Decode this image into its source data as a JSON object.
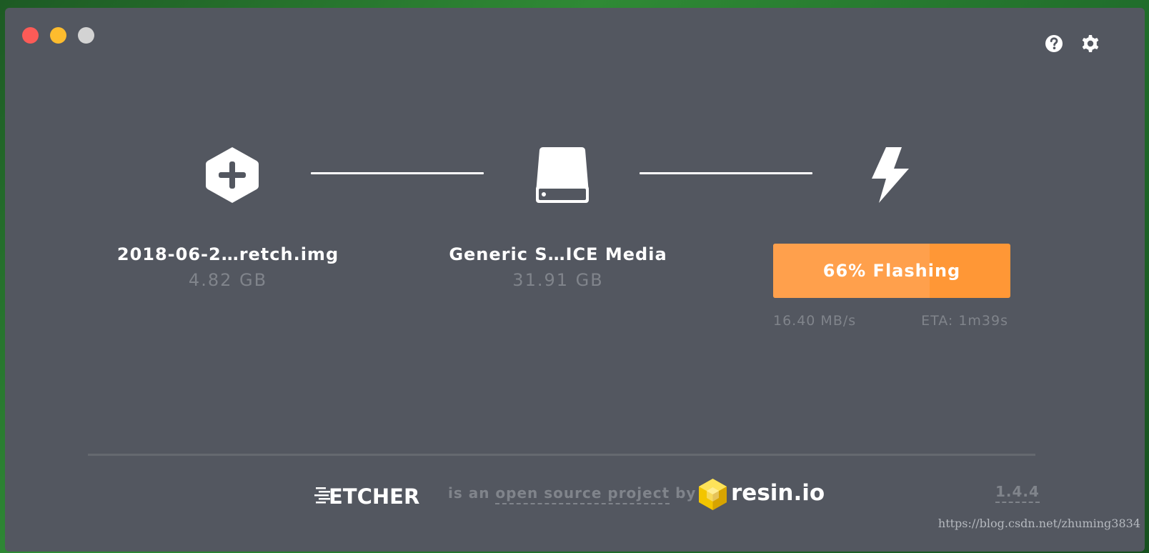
{
  "window": {
    "controls": {
      "close_color": "#fc5b57",
      "minimize_color": "#fdbc2e",
      "maximize_color": "#d3d3d3"
    },
    "top_icons": [
      "help-icon",
      "gear-icon"
    ]
  },
  "steps": {
    "image": {
      "icon": "hexagon-plus-icon",
      "title": "2018-06-2…retch.img",
      "size": "4.82 GB"
    },
    "drive": {
      "icon": "drive-icon",
      "title": "Generic S…ICE Media",
      "size": "31.91 GB"
    },
    "flash": {
      "icon": "lightning-icon",
      "progress_label": "66% Flashing",
      "progress_percent": 66,
      "speed": "16.40 MB/s",
      "eta": "ETA: 1m39s",
      "colors": {
        "accent": "#ff9736",
        "fill": "#ffa04c"
      }
    }
  },
  "footer": {
    "brand_text": "ETCHER",
    "tagline_prefix": "is an ",
    "tagline_link": "open source project",
    "tagline_suffix": " by",
    "company_logo_text": "resin.io",
    "version": "1.4.4"
  },
  "watermark": "https://blog.csdn.net/zhuming3834"
}
